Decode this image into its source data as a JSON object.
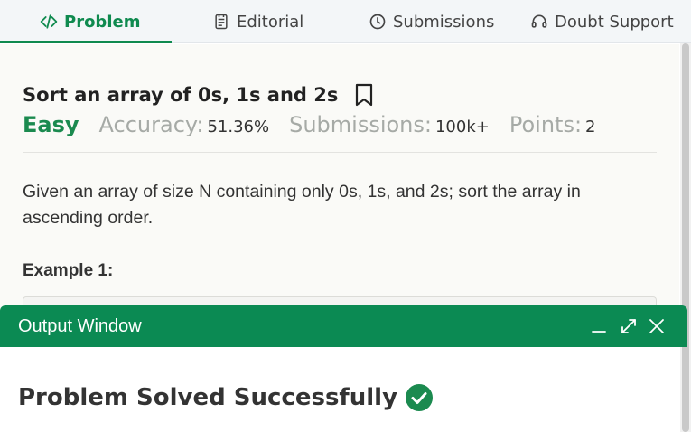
{
  "tabs": [
    {
      "label": "Problem",
      "icon": "code-icon",
      "active": true
    },
    {
      "label": "Editorial",
      "icon": "document-icon",
      "active": false
    },
    {
      "label": "Submissions",
      "icon": "clock-icon",
      "active": false
    },
    {
      "label": "Doubt Support",
      "icon": "headset-icon",
      "active": false
    }
  ],
  "problem": {
    "title": "Sort an array of 0s, 1s and 2s",
    "difficulty": "Easy",
    "accuracy_label": "Accuracy:",
    "accuracy_value": "51.36%",
    "submissions_label": "Submissions:",
    "submissions_value": "100k+",
    "points_label": "Points:",
    "points_value": "2",
    "description": "Given an array of size N containing only 0s, 1s, and 2s; sort the array in ascending order.",
    "example_heading": "Example 1:"
  },
  "output_window": {
    "title": "Output Window",
    "result": "Problem Solved Successfully"
  },
  "colors": {
    "accent": "#0f8a4f",
    "output_header": "#0b8a53",
    "difficulty_easy": "#1b8a4f",
    "muted_label": "#a6aaa6"
  }
}
